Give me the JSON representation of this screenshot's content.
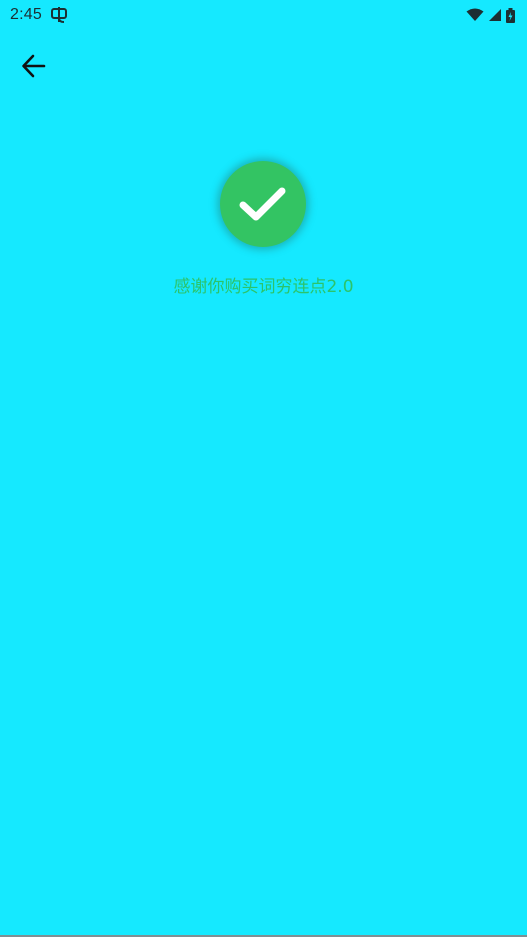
{
  "status_bar": {
    "time": "2:45",
    "icons": [
      "notification-icon",
      "wifi-icon",
      "signal-icon",
      "battery-icon"
    ]
  },
  "toolbar": {
    "back_icon": "arrow-left-icon"
  },
  "content": {
    "success_icon": "checkmark-icon",
    "message": "感谢你购买词穷连点2.0"
  },
  "colors": {
    "background": "#15e9ff",
    "badge": "#33c463",
    "message_text": "#2cc46a"
  }
}
